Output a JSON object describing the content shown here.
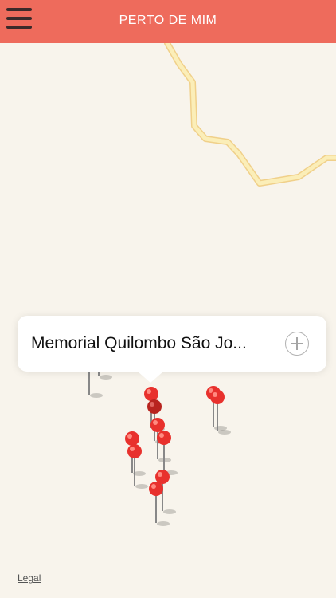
{
  "header": {
    "title": "PERTO DE MIM",
    "menu_icon": "hamburger-menu-icon",
    "color": "#ee6b5c"
  },
  "map": {
    "road_color": "#f3d88a",
    "pin_color": "#e8312d",
    "callout": {
      "text": "Memorial Quilombo São Jo...",
      "add_icon": "plus-circle-icon"
    },
    "legal_label": "Legal"
  }
}
